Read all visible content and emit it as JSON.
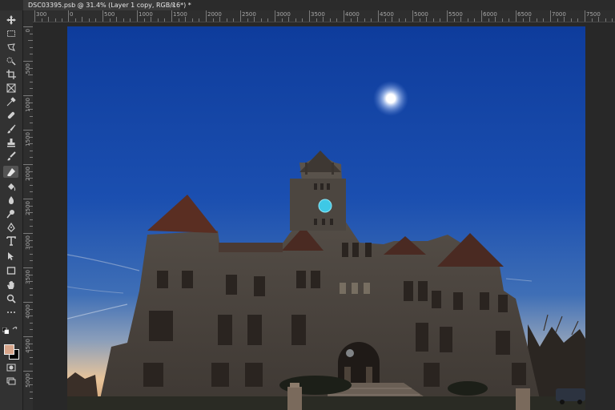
{
  "document_tab": {
    "title": "DSC03395.psb @ 31.4% (Layer 1 copy, RGB/16*) *",
    "close": "×"
  },
  "ruler_top": {
    "labels": [
      "300",
      "0",
      "500",
      "1000",
      "1500",
      "2000",
      "2500",
      "3000",
      "3500",
      "4000",
      "4500",
      "5000",
      "5500",
      "6000",
      "6500",
      "7000",
      "7500"
    ]
  },
  "ruler_left": {
    "labels": [
      "0",
      "500",
      "1000",
      "1500",
      "2000",
      "2500",
      "3000",
      "3500",
      "4000",
      "4500",
      "5000"
    ]
  },
  "tools": [
    "move-tool",
    "marquee-tool",
    "lasso-tool",
    "quick-selection-tool",
    "crop-tool",
    "frame-tool",
    "eyedropper-tool",
    "spot-healing-tool",
    "brush-tool",
    "clone-stamp-tool",
    "history-brush-tool",
    "eraser-tool",
    "gradient-tool",
    "blur-tool",
    "dodge-tool",
    "pen-tool",
    "type-tool",
    "path-selection-tool",
    "rectangle-tool",
    "hand-tool",
    "zoom-tool",
    "more-tools"
  ],
  "colors": {
    "foreground": "#d8a58a",
    "background": "#000000",
    "ui_panel": "#323232",
    "sky_top": "#0e3c9c",
    "sky_horizon": "#e8c49a",
    "clock_face": "#3ec8e6"
  }
}
